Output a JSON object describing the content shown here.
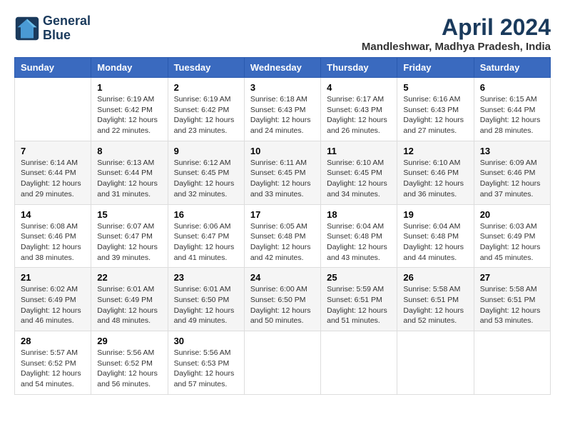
{
  "logo": {
    "line1": "General",
    "line2": "Blue"
  },
  "title": "April 2024",
  "subtitle": "Mandleshwar, Madhya Pradesh, India",
  "days_of_week": [
    "Sunday",
    "Monday",
    "Tuesday",
    "Wednesday",
    "Thursday",
    "Friday",
    "Saturday"
  ],
  "weeks": [
    [
      {
        "day": "",
        "sunrise": "",
        "sunset": "",
        "daylight": ""
      },
      {
        "day": "1",
        "sunrise": "Sunrise: 6:19 AM",
        "sunset": "Sunset: 6:42 PM",
        "daylight": "Daylight: 12 hours and 22 minutes."
      },
      {
        "day": "2",
        "sunrise": "Sunrise: 6:19 AM",
        "sunset": "Sunset: 6:42 PM",
        "daylight": "Daylight: 12 hours and 23 minutes."
      },
      {
        "day": "3",
        "sunrise": "Sunrise: 6:18 AM",
        "sunset": "Sunset: 6:43 PM",
        "daylight": "Daylight: 12 hours and 24 minutes."
      },
      {
        "day": "4",
        "sunrise": "Sunrise: 6:17 AM",
        "sunset": "Sunset: 6:43 PM",
        "daylight": "Daylight: 12 hours and 26 minutes."
      },
      {
        "day": "5",
        "sunrise": "Sunrise: 6:16 AM",
        "sunset": "Sunset: 6:43 PM",
        "daylight": "Daylight: 12 hours and 27 minutes."
      },
      {
        "day": "6",
        "sunrise": "Sunrise: 6:15 AM",
        "sunset": "Sunset: 6:44 PM",
        "daylight": "Daylight: 12 hours and 28 minutes."
      }
    ],
    [
      {
        "day": "7",
        "sunrise": "Sunrise: 6:14 AM",
        "sunset": "Sunset: 6:44 PM",
        "daylight": "Daylight: 12 hours and 29 minutes."
      },
      {
        "day": "8",
        "sunrise": "Sunrise: 6:13 AM",
        "sunset": "Sunset: 6:44 PM",
        "daylight": "Daylight: 12 hours and 31 minutes."
      },
      {
        "day": "9",
        "sunrise": "Sunrise: 6:12 AM",
        "sunset": "Sunset: 6:45 PM",
        "daylight": "Daylight: 12 hours and 32 minutes."
      },
      {
        "day": "10",
        "sunrise": "Sunrise: 6:11 AM",
        "sunset": "Sunset: 6:45 PM",
        "daylight": "Daylight: 12 hours and 33 minutes."
      },
      {
        "day": "11",
        "sunrise": "Sunrise: 6:10 AM",
        "sunset": "Sunset: 6:45 PM",
        "daylight": "Daylight: 12 hours and 34 minutes."
      },
      {
        "day": "12",
        "sunrise": "Sunrise: 6:10 AM",
        "sunset": "Sunset: 6:46 PM",
        "daylight": "Daylight: 12 hours and 36 minutes."
      },
      {
        "day": "13",
        "sunrise": "Sunrise: 6:09 AM",
        "sunset": "Sunset: 6:46 PM",
        "daylight": "Daylight: 12 hours and 37 minutes."
      }
    ],
    [
      {
        "day": "14",
        "sunrise": "Sunrise: 6:08 AM",
        "sunset": "Sunset: 6:46 PM",
        "daylight": "Daylight: 12 hours and 38 minutes."
      },
      {
        "day": "15",
        "sunrise": "Sunrise: 6:07 AM",
        "sunset": "Sunset: 6:47 PM",
        "daylight": "Daylight: 12 hours and 39 minutes."
      },
      {
        "day": "16",
        "sunrise": "Sunrise: 6:06 AM",
        "sunset": "Sunset: 6:47 PM",
        "daylight": "Daylight: 12 hours and 41 minutes."
      },
      {
        "day": "17",
        "sunrise": "Sunrise: 6:05 AM",
        "sunset": "Sunset: 6:48 PM",
        "daylight": "Daylight: 12 hours and 42 minutes."
      },
      {
        "day": "18",
        "sunrise": "Sunrise: 6:04 AM",
        "sunset": "Sunset: 6:48 PM",
        "daylight": "Daylight: 12 hours and 43 minutes."
      },
      {
        "day": "19",
        "sunrise": "Sunrise: 6:04 AM",
        "sunset": "Sunset: 6:48 PM",
        "daylight": "Daylight: 12 hours and 44 minutes."
      },
      {
        "day": "20",
        "sunrise": "Sunrise: 6:03 AM",
        "sunset": "Sunset: 6:49 PM",
        "daylight": "Daylight: 12 hours and 45 minutes."
      }
    ],
    [
      {
        "day": "21",
        "sunrise": "Sunrise: 6:02 AM",
        "sunset": "Sunset: 6:49 PM",
        "daylight": "Daylight: 12 hours and 46 minutes."
      },
      {
        "day": "22",
        "sunrise": "Sunrise: 6:01 AM",
        "sunset": "Sunset: 6:49 PM",
        "daylight": "Daylight: 12 hours and 48 minutes."
      },
      {
        "day": "23",
        "sunrise": "Sunrise: 6:01 AM",
        "sunset": "Sunset: 6:50 PM",
        "daylight": "Daylight: 12 hours and 49 minutes."
      },
      {
        "day": "24",
        "sunrise": "Sunrise: 6:00 AM",
        "sunset": "Sunset: 6:50 PM",
        "daylight": "Daylight: 12 hours and 50 minutes."
      },
      {
        "day": "25",
        "sunrise": "Sunrise: 5:59 AM",
        "sunset": "Sunset: 6:51 PM",
        "daylight": "Daylight: 12 hours and 51 minutes."
      },
      {
        "day": "26",
        "sunrise": "Sunrise: 5:58 AM",
        "sunset": "Sunset: 6:51 PM",
        "daylight": "Daylight: 12 hours and 52 minutes."
      },
      {
        "day": "27",
        "sunrise": "Sunrise: 5:58 AM",
        "sunset": "Sunset: 6:51 PM",
        "daylight": "Daylight: 12 hours and 53 minutes."
      }
    ],
    [
      {
        "day": "28",
        "sunrise": "Sunrise: 5:57 AM",
        "sunset": "Sunset: 6:52 PM",
        "daylight": "Daylight: 12 hours and 54 minutes."
      },
      {
        "day": "29",
        "sunrise": "Sunrise: 5:56 AM",
        "sunset": "Sunset: 6:52 PM",
        "daylight": "Daylight: 12 hours and 56 minutes."
      },
      {
        "day": "30",
        "sunrise": "Sunrise: 5:56 AM",
        "sunset": "Sunset: 6:53 PM",
        "daylight": "Daylight: 12 hours and 57 minutes."
      },
      {
        "day": "",
        "sunrise": "",
        "sunset": "",
        "daylight": ""
      },
      {
        "day": "",
        "sunrise": "",
        "sunset": "",
        "daylight": ""
      },
      {
        "day": "",
        "sunrise": "",
        "sunset": "",
        "daylight": ""
      },
      {
        "day": "",
        "sunrise": "",
        "sunset": "",
        "daylight": ""
      }
    ]
  ]
}
